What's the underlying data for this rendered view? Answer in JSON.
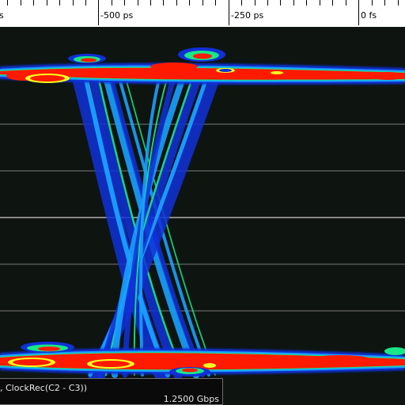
{
  "ruler": {
    "labels": [
      "-500 ps",
      "-250 ps",
      "0 fs"
    ],
    "partial_label": "s"
  },
  "status": {
    "channel_text": ", ClockRec(C2 - C3))",
    "rate_text": "1.2500 Gbps"
  },
  "colors": {
    "background": "#0e1410",
    "gridline": "#8a8a8a",
    "hot": "#ff1a00",
    "warm": "#ffff20",
    "mid": "#18e888",
    "cool": "#1aa0ff",
    "cold": "#1030d8"
  }
}
